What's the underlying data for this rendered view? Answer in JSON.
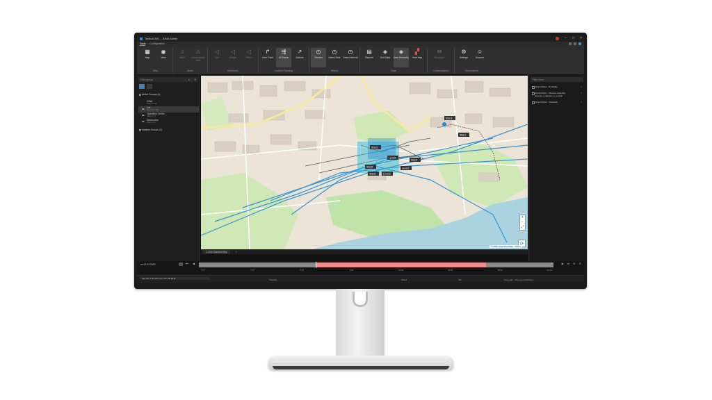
{
  "window": {
    "title": "Tactical AVL – IDNA Admin"
  },
  "ribbon": {
    "tabs": [
      "Tools",
      "Configuration"
    ],
    "buttons": {
      "map": "Map",
      "view": "View",
      "alert": "Alert",
      "acknowledge": "Acknowledge Alert",
      "safe": "Safe",
      "danger": "Danger",
      "others": "Others",
      "user_track": "User Track",
      "all_tracks": "All Tracks",
      "actions": "Actions",
      "timeline": "Timeline",
      "select_time": "Select Time",
      "select_interval": "Select Interval",
      "reports": "Reports",
      "sort_data": "Sort Data",
      "data_hierarchy": "Data Hierarchy",
      "heat_map": "Heat Map",
      "messages": "Messages",
      "settings": "Settings",
      "account": "Account"
    },
    "groups": {
      "map": "Map",
      "alerts": "Alerts",
      "geofences": "Geofences",
      "location_tracking": "Location Tracking",
      "history": "History",
      "data": "Data",
      "communication": "Communication",
      "environment": "Environment"
    }
  },
  "left_panel": {
    "filter_placeholder": "Filter groups",
    "tree": [
      {
        "label": "Active Groups (4)",
        "meta": ""
      },
      {
        "label": "GINA",
        "meta": "Users 1 / 18"
      },
      {
        "label": "Cat",
        "meta": "Users 17 / 132"
      },
      {
        "label": "Operation Center",
        "meta": "Users 1 / 3"
      },
      {
        "label": "Nemocnice",
        "meta": "Users 1 / 1"
      },
      {
        "label": "Inactive Groups (1)",
        "meta": ""
      }
    ]
  },
  "map": {
    "tab_label": "1 OSM Standard Map",
    "add_tab": "+",
    "attribution": "© 2020 OpenStreetMap · 300 m",
    "zoom_in": "+",
    "zoom_out": "−",
    "labels": [
      "Stan3",
      "Stan1",
      "Stan2",
      "Level1",
      "Stan4",
      "Stan5",
      "Level2",
      "Stan6",
      "Level3"
    ]
  },
  "right_panel": {
    "filter_placeholder": "Filter users",
    "items": [
      "Urban Patrol - Prohlidky",
      "Urban Patrol - Obecne materiály",
      "dovezte a zajistěte ve vozidle",
      "Urban Patrol - Ostrav66"
    ]
  },
  "timeline": {
    "date": "so 21.03.2020",
    "ticks": [
      "0:00",
      "3:00",
      "6:00",
      "9:00",
      "12:00",
      "15:00",
      "18:00",
      "21:00"
    ],
    "cursor_fraction": 0.33,
    "history_from": 0.33,
    "history_to": 0.81
  },
  "status_bar": {
    "coords": "Lat: 50° 2' 13.20\" Lon: 14° 26' 48.8\"",
    "s1": "Tracked",
    "s2": "Stan2",
    "s3": "0/0",
    "s4": "Formulář – Zamezení přístupu"
  },
  "colors": {
    "track_blue": "#1f8ad6",
    "track_cyan": "#22b8d8",
    "history_red": "#f28b8b",
    "ribbon_bg": "#2f2f2f",
    "map_bg": "#e9e3d8"
  }
}
